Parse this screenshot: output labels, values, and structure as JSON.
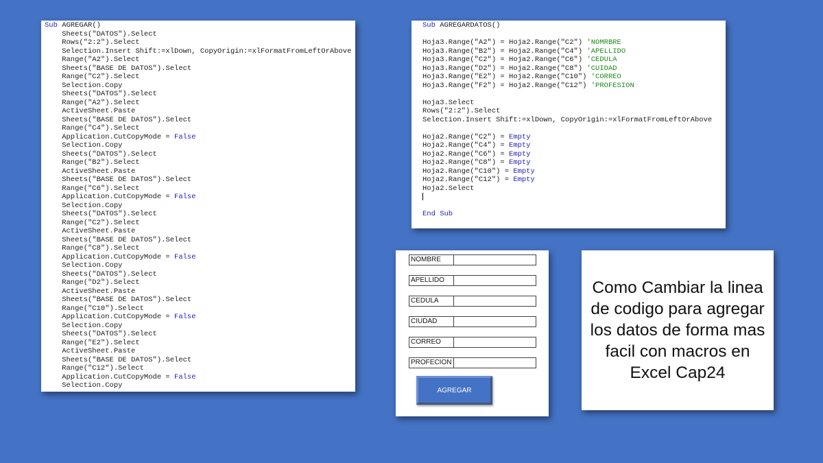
{
  "code_left": {
    "lines": [
      [
        [
          "kw",
          "Sub "
        ],
        [
          "",
          "AGREGAR()"
        ]
      ],
      [
        [
          "",
          "    Sheets(\"DATOS\").Select"
        ]
      ],
      [
        [
          "",
          "    Rows(\"2:2\").Select"
        ]
      ],
      [
        [
          "",
          "    Selection.Insert Shift:=xlDown, CopyOrigin:=xlFormatFromLeftOrAbove"
        ]
      ],
      [
        [
          "",
          "    Range(\"A2\").Select"
        ]
      ],
      [
        [
          "",
          "    Sheets(\"BASE DE DATOS\").Select"
        ]
      ],
      [
        [
          "",
          "    Range(\"C2\").Select"
        ]
      ],
      [
        [
          "",
          "    Selection.Copy"
        ]
      ],
      [
        [
          "",
          "    Sheets(\"DATOS\").Select"
        ]
      ],
      [
        [
          "",
          "    Range(\"A2\").Select"
        ]
      ],
      [
        [
          "",
          "    ActiveSheet.Paste"
        ]
      ],
      [
        [
          "",
          "    Sheets(\"BASE DE DATOS\").Select"
        ]
      ],
      [
        [
          "",
          "    Range(\"C4\").Select"
        ]
      ],
      [
        [
          "",
          "    Application.CutCopyMode = "
        ],
        [
          "kw",
          "False"
        ]
      ],
      [
        [
          "",
          "    Selection.Copy"
        ]
      ],
      [
        [
          "",
          "    Sheets(\"DATOS\").Select"
        ]
      ],
      [
        [
          "",
          "    Range(\"B2\").Select"
        ]
      ],
      [
        [
          "",
          "    ActiveSheet.Paste"
        ]
      ],
      [
        [
          "",
          "    Sheets(\"BASE DE DATOS\").Select"
        ]
      ],
      [
        [
          "",
          "    Range(\"C6\").Select"
        ]
      ],
      [
        [
          "",
          "    Application.CutCopyMode = "
        ],
        [
          "kw",
          "False"
        ]
      ],
      [
        [
          "",
          "    Selection.Copy"
        ]
      ],
      [
        [
          "",
          "    Sheets(\"DATOS\").Select"
        ]
      ],
      [
        [
          "",
          "    Range(\"C2\").Select"
        ]
      ],
      [
        [
          "",
          "    ActiveSheet.Paste"
        ]
      ],
      [
        [
          "",
          "    Sheets(\"BASE DE DATOS\").Select"
        ]
      ],
      [
        [
          "",
          "    Range(\"C8\").Select"
        ]
      ],
      [
        [
          "",
          "    Application.CutCopyMode = "
        ],
        [
          "kw",
          "False"
        ]
      ],
      [
        [
          "",
          "    Selection.Copy"
        ]
      ],
      [
        [
          "",
          "    Sheets(\"DATOS\").Select"
        ]
      ],
      [
        [
          "",
          "    Range(\"D2\").Select"
        ]
      ],
      [
        [
          "",
          "    ActiveSheet.Paste"
        ]
      ],
      [
        [
          "",
          "    Sheets(\"BASE DE DATOS\").Select"
        ]
      ],
      [
        [
          "",
          "    Range(\"C10\").Select"
        ]
      ],
      [
        [
          "",
          "    Application.CutCopyMode = "
        ],
        [
          "kw",
          "False"
        ]
      ],
      [
        [
          "",
          "    Selection.Copy"
        ]
      ],
      [
        [
          "",
          "    Sheets(\"DATOS\").Select"
        ]
      ],
      [
        [
          "",
          "    Range(\"E2\").Select"
        ]
      ],
      [
        [
          "",
          "    ActiveSheet.Paste"
        ]
      ],
      [
        [
          "",
          "    Sheets(\"BASE DE DATOS\").Select"
        ]
      ],
      [
        [
          "",
          "    Range(\"C12\").Select"
        ]
      ],
      [
        [
          "",
          "    Application.CutCopyMode = "
        ],
        [
          "kw",
          "False"
        ]
      ],
      [
        [
          "",
          "    Selection.Copy"
        ]
      ]
    ]
  },
  "code_right": {
    "lines": [
      [
        [
          "kw",
          "Sub "
        ],
        [
          "",
          "AGREGARDATOS()"
        ]
      ],
      [
        [
          "",
          ""
        ]
      ],
      [
        [
          "",
          "Hoja3.Range(\"A2\") = Hoja2.Range(\"C2\") "
        ],
        [
          "cm",
          "'NOMRBRE"
        ]
      ],
      [
        [
          "",
          "Hoja3.Range(\"B2\") = Hoja2.Range(\"C4\") "
        ],
        [
          "cm",
          "'APELLIDO"
        ]
      ],
      [
        [
          "",
          "Hoja3.Range(\"C2\") = Hoja2.Range(\"C6\") "
        ],
        [
          "cm",
          "'CEDULA"
        ]
      ],
      [
        [
          "",
          "Hoja3.Range(\"D2\") = Hoja2.Range(\"C8\") "
        ],
        [
          "cm",
          "'CUIDAD"
        ]
      ],
      [
        [
          "",
          "Hoja3.Range(\"E2\") = Hoja2.Range(\"C10\") "
        ],
        [
          "cm",
          "'CORREO"
        ]
      ],
      [
        [
          "",
          "Hoja3.Range(\"F2\") = Hoja2.Range(\"C12\") "
        ],
        [
          "cm",
          "'PROFESION"
        ]
      ],
      [
        [
          "",
          ""
        ]
      ],
      [
        [
          "",
          "Hoja3.Select"
        ]
      ],
      [
        [
          "",
          "Rows(\"2:2\").Select"
        ]
      ],
      [
        [
          "",
          "Selection.Insert Shift:=xlDown, CopyOrigin:=xlFormatFromLeftOrAbove"
        ]
      ],
      [
        [
          "",
          ""
        ]
      ],
      [
        [
          "",
          "Hoja2.Range(\"C2\") = "
        ],
        [
          "kw",
          "Empty"
        ]
      ],
      [
        [
          "",
          "Hoja2.Range(\"C4\") = "
        ],
        [
          "kw",
          "Empty"
        ]
      ],
      [
        [
          "",
          "Hoja2.Range(\"C6\") = "
        ],
        [
          "kw",
          "Empty"
        ]
      ],
      [
        [
          "",
          "Hoja2.Range(\"C8\") = "
        ],
        [
          "kw",
          "Empty"
        ]
      ],
      [
        [
          "",
          "Hoja2.Range(\"C10\") = "
        ],
        [
          "kw",
          "Empty"
        ]
      ],
      [
        [
          "",
          "Hoja2.Range(\"C12\") = "
        ],
        [
          "kw",
          "Empty"
        ]
      ],
      [
        [
          "",
          "Hoja2.Select"
        ]
      ],
      [
        [
          "cursor",
          ""
        ]
      ],
      [
        [
          "",
          ""
        ]
      ],
      [
        [
          "kw",
          "End Sub"
        ]
      ]
    ]
  },
  "form": {
    "fields": [
      "NOMBRE",
      "APELLIDO",
      "CEDULA",
      "CIUDAD",
      "CORREO",
      "PROFECION"
    ],
    "button_label": "AGREGAR"
  },
  "title": {
    "text": "Como Cambiar la linea de codigo para agregar los datos de forma mas facil con macros en Excel Cap24"
  },
  "colors": {
    "background": "#4472c4",
    "keyword": "#1f1fb8",
    "comment": "#1a8a1a"
  }
}
